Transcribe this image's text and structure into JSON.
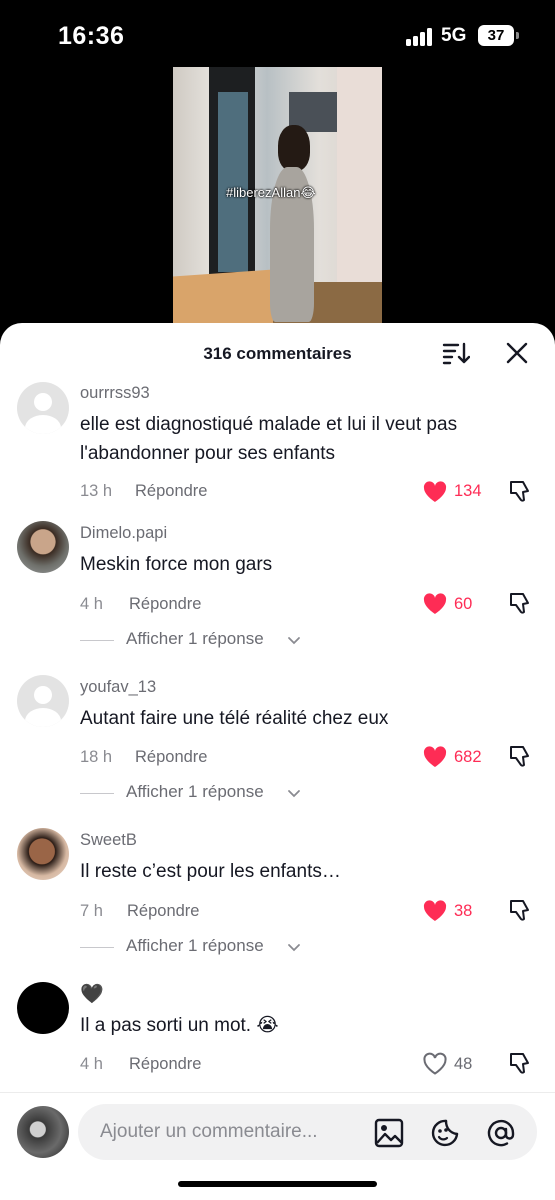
{
  "status_bar": {
    "time": "16:36",
    "network": "5G",
    "battery": "37"
  },
  "video": {
    "overlay_text": "#liberezAllan",
    "overlay_emoji": "😂"
  },
  "sheet": {
    "title": "316 commentaires"
  },
  "comments": [
    {
      "username": "ourrrss93",
      "text": "elle est diagnostiqué malade et lui il veut pas l'abandonner pour ses enfants",
      "time": "13 h",
      "reply_label": "Répondre",
      "likes": "134",
      "liked": true,
      "view_replies": ""
    },
    {
      "username": "Dimelo.papi",
      "text": "Meskin force mon gars",
      "time": "4 h",
      "reply_label": "Répondre",
      "likes": "60",
      "liked": true,
      "view_replies": "Afficher 1 réponse"
    },
    {
      "username": "youfav_13",
      "text": "Autant faire une télé réalité chez eux",
      "time": "18 h",
      "reply_label": "Répondre",
      "likes": "682",
      "liked": true,
      "view_replies": "Afficher 1 réponse"
    },
    {
      "username": "SweetB",
      "text": "Il reste c’est pour les enfants…",
      "time": "7 h",
      "reply_label": "Répondre",
      "likes": "38",
      "liked": true,
      "view_replies": "Afficher 1 réponse"
    },
    {
      "username": "🖤",
      "text": "Il a pas sorti un mot. 😭",
      "time": "4 h",
      "reply_label": "Répondre",
      "likes": "48",
      "liked": false,
      "view_replies": ""
    }
  ],
  "composer": {
    "placeholder": "Ajouter un commentaire..."
  },
  "colors": {
    "like_red": "#fe2c55",
    "text_dark": "#161823",
    "text_grey": "#6b6c73"
  }
}
